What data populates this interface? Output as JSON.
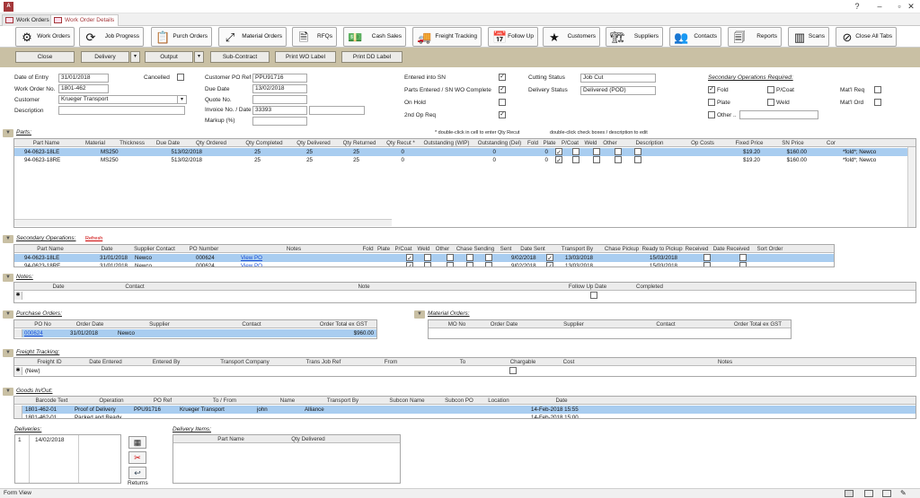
{
  "tabs": [
    "Work Orders",
    "Work Order Details"
  ],
  "nav_buttons": [
    {
      "label": "Work Orders",
      "icon": "gear-icon",
      "glyph": "⚙"
    },
    {
      "label": "Job Progress",
      "icon": "refresh-icon",
      "glyph": "⟳"
    },
    {
      "label": "Purch Orders",
      "icon": "clipboard-icon",
      "glyph": "📋"
    },
    {
      "label": "Material Orders",
      "icon": "expand-icon",
      "glyph": "⤢"
    },
    {
      "label": "RFQs",
      "icon": "document-icon",
      "glyph": "🗎"
    },
    {
      "label": "Cash Sales",
      "icon": "cash-icon",
      "glyph": "💵"
    },
    {
      "label": "Freight Tracking",
      "icon": "truck-icon",
      "glyph": "🚚"
    },
    {
      "label": "Follow Up",
      "icon": "calendar-icon",
      "glyph": "📅"
    },
    {
      "label": "Customers",
      "icon": "star-icon",
      "glyph": "★"
    },
    {
      "label": "Suppliers",
      "icon": "forklift-icon",
      "glyph": "🏗"
    },
    {
      "label": "Contacts",
      "icon": "people-icon",
      "glyph": "👥"
    },
    {
      "label": "Reports",
      "icon": "report-icon",
      "glyph": "🗐"
    },
    {
      "label": "Scans",
      "icon": "barcode-icon",
      "glyph": "▥"
    },
    {
      "label": "Close All Tabs",
      "icon": "no-entry-icon",
      "glyph": "⊘"
    }
  ],
  "commands": {
    "close": "Close",
    "delivery": "Delivery",
    "output": "Output",
    "sub_contract": "Sub-Contract",
    "print_wo": "Print WO Label",
    "print_dd": "Print DD Label"
  },
  "form": {
    "date_of_entry_label": "Date of Entry",
    "date_of_entry": "31/01/2018",
    "work_order_no_label": "Work Order No.",
    "work_order_no": "1801-462",
    "customer_label": "Customer",
    "customer": "Krueger Transport",
    "description_label": "Description",
    "description": "",
    "cancelled_label": "Cancelled",
    "customer_po_label": "Customer PO Ref",
    "customer_po": "PPU91716",
    "due_date_label": "Due Date",
    "due_date": "13/02/2018",
    "quote_no_label": "Quote No.",
    "quote_no": "",
    "invoice_label": "Invoice No. / Date",
    "invoice_no": "33393",
    "invoice_date": "",
    "markup_label": "Markup (%)",
    "markup": "",
    "entered_sn_label": "Entered into SN",
    "parts_entered_label": "Parts Entered / SN WO Complete",
    "on_hold_label": "On Hold",
    "second_op_label": "2nd Op Req",
    "cutting_status_label": "Cutting Status",
    "cutting_status": "Job Cut",
    "delivery_status_label": "Delivery Status",
    "delivery_status": "Delivered (POD)",
    "secondary_req_label": "Secondary Operations Required:",
    "fold_label": "Fold",
    "pcoat_label": "P/Coat",
    "plate_label": "Plate",
    "weld_label": "Weld",
    "other_label": "Other ..",
    "matl_req_label": "Mat'l Req",
    "matl_ord_label": "Mat'l Ord"
  },
  "parts": {
    "section_title": "Parts:",
    "hint1": "* double-click in cell to enter Qty Recut",
    "hint2": "double-click check boxes / description to edit",
    "columns": [
      "Part Name",
      "Material",
      "Thickness",
      "Due Date",
      "Qty Ordered",
      "Qty Completed",
      "Qty Delivered",
      "Qty Returned",
      "Qty Recut *",
      "Outstanding (WIP)",
      "Outstanding (Del)",
      "Fold",
      "Plate",
      "P/Coat",
      "Weld",
      "Other",
      "Description",
      "Op Costs",
      "Fixed Price",
      "SN Price",
      "Cor"
    ],
    "rows": [
      {
        "part": "94-0623-18LE",
        "material": "MS250",
        "thickness": "5",
        "due": "13/02/2018",
        "ordered": "25",
        "completed": "25",
        "delivered": "25",
        "returned": "0",
        "wip": "0",
        "del": "0",
        "op_cost": "$19.20",
        "fixed": "$160.00",
        "cor": "*fold*; Newco"
      },
      {
        "part": "94-0623-18RE",
        "material": "MS250",
        "thickness": "5",
        "due": "13/02/2018",
        "ordered": "25",
        "completed": "25",
        "delivered": "25",
        "returned": "0",
        "wip": "0",
        "del": "0",
        "op_cost": "$19.20",
        "fixed": "$160.00",
        "cor": "*fold*; Newco"
      }
    ]
  },
  "secondary_ops": {
    "section_title": "Secondary Operations:",
    "refresh": "Refresh",
    "columns": [
      "Part Name",
      "Date",
      "Supplier Contact",
      "PO Number",
      "Notes",
      "Fold",
      "Plate",
      "P/Coat",
      "Weld",
      "Other",
      "Chase Sending",
      "Sent",
      "Date Sent",
      "Transport By",
      "Chase Pickup",
      "Ready to Pickup",
      "Received",
      "Date Received",
      "Sort Order"
    ],
    "rows": [
      {
        "part": "94-0623-18LE",
        "date": "31/01/2018",
        "contact": "Newco",
        "po": "000624",
        "view": "View PO",
        "chase": "9/02/2018",
        "date_sent": "13/03/2018",
        "chase_pickup": "15/03/2018"
      },
      {
        "part": "94-0623-18RE",
        "date": "31/01/2018",
        "contact": "Newco",
        "po": "000624",
        "view": "View PO",
        "chase": "9/02/2018",
        "date_sent": "13/03/2018",
        "chase_pickup": "15/03/2018"
      }
    ]
  },
  "notes": {
    "section_title": "Notes:",
    "columns": [
      "Date",
      "Contact",
      "Note",
      "Follow Up Date",
      "Completed"
    ]
  },
  "purchase_orders": {
    "section_title": "Purchase Orders:",
    "columns": [
      "PO No",
      "Order Date",
      "Supplier",
      "Contact",
      "Order Total ex GST"
    ],
    "rows": [
      {
        "po": "000624",
        "date": "31/01/2018",
        "supplier": "Newco",
        "contact": "",
        "total": "$960.00"
      }
    ]
  },
  "material_orders": {
    "section_title": "Material Orders:",
    "columns": [
      "MO No",
      "Order Date",
      "Supplier",
      "Contact",
      "Order Total ex GST"
    ]
  },
  "freight": {
    "section_title": "Freight Tracking:",
    "columns": [
      "Freight ID",
      "Date Entered",
      "Entered By",
      "Transport Company",
      "Trans Job Ref",
      "From",
      "To",
      "Chargable",
      "Cost",
      "Notes"
    ],
    "new_row": "(New)"
  },
  "goods": {
    "section_title": "Goods In/Out:",
    "columns": [
      "Barcode Text",
      "Operation",
      "PO Ref",
      "To / From",
      "Name",
      "Transport By",
      "Subcon Name",
      "Subcon PO",
      "Location",
      "Date"
    ],
    "rows": [
      {
        "barcode": "1801-462-01",
        "operation": "Proof of Delivery",
        "po_ref": "PPU91716",
        "to_from": "Krueger Transport",
        "name": "john",
        "transport": "Alliance",
        "date": "14-Feb-2018 15:55"
      },
      {
        "barcode": "1801-462-01",
        "operation": "Packed and Ready",
        "po_ref": "",
        "to_from": "",
        "name": "",
        "transport": "",
        "date": "14-Feb-2018 15:00"
      }
    ]
  },
  "deliveries": {
    "section_title": "Deliveries:",
    "rows": [
      {
        "no": "1",
        "date": "14/02/2018"
      }
    ],
    "returns_label": "Returns"
  },
  "delivery_items": {
    "section_title": "Delivery Items:",
    "columns": [
      "Part Name",
      "Qty Delivered"
    ]
  },
  "status_bar": "Form View",
  "new_record_marker": "✱",
  "colors": {
    "accent": "#a4373a",
    "command_bar": "#c9c0a4",
    "selection": "#a9cdf0"
  }
}
